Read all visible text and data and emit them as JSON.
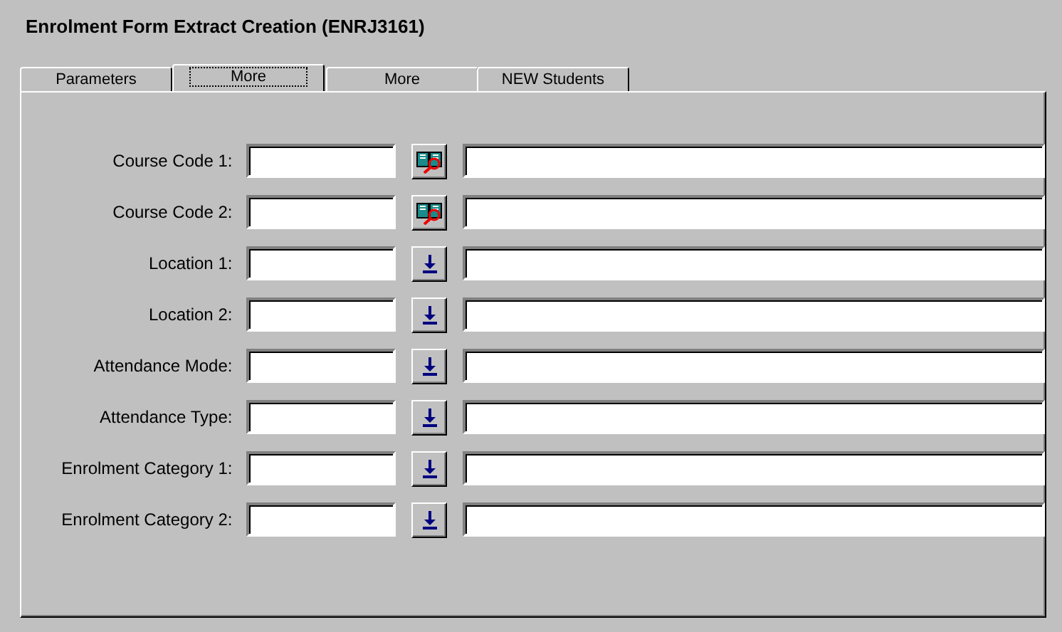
{
  "window": {
    "title": "Enrolment Form Extract Creation (ENRJ3161)"
  },
  "tabs": [
    {
      "label": "Parameters",
      "selected": false
    },
    {
      "label": "More",
      "selected": true
    },
    {
      "label": "More",
      "selected": false
    },
    {
      "label": "NEW Students",
      "selected": false
    }
  ],
  "fields": [
    {
      "label": "Course Code 1:",
      "kind": "lookup"
    },
    {
      "label": "Course Code 2:",
      "kind": "lookup"
    },
    {
      "label": "Location 1:",
      "kind": "dropdown"
    },
    {
      "label": "Location 2:",
      "kind": "dropdown"
    },
    {
      "label": "Attendance Mode:",
      "kind": "dropdown"
    },
    {
      "label": "Attendance Type:",
      "kind": "dropdown"
    },
    {
      "label": "Enrolment Category 1:",
      "kind": "dropdown"
    },
    {
      "label": "Enrolment Category 2:",
      "kind": "dropdown"
    }
  ]
}
